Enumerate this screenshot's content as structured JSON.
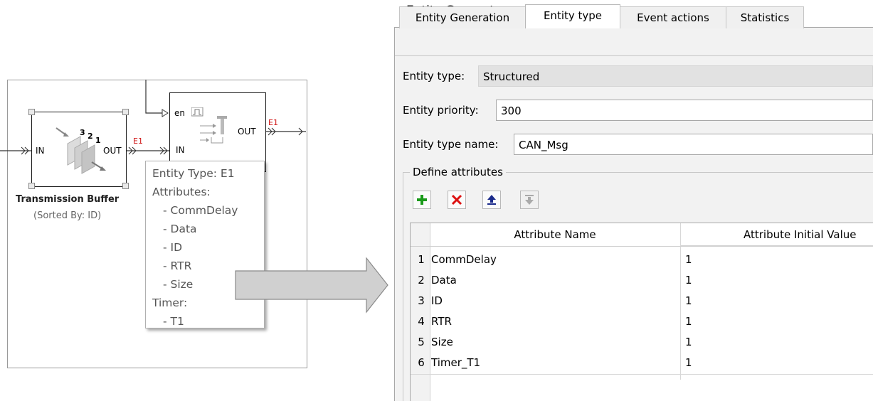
{
  "model": {
    "buffer_block": {
      "in_label": "IN",
      "out_label": "OUT",
      "digits": [
        "3",
        "2",
        "1"
      ],
      "title": "Transmission Buffer",
      "subtitle": "(Sorted By: ID)",
      "out_signal": "E1"
    },
    "gate_block": {
      "en_label": "en",
      "in_label": "IN",
      "out_label": "OUT",
      "out_signal": "E1"
    },
    "tooltip": {
      "lines": [
        "Entity Type: E1",
        "Attributes:",
        "- CommDelay",
        "- Data",
        "- ID",
        "- RTR",
        "- Size",
        "Timer:",
        "- T1"
      ]
    }
  },
  "dialog": {
    "title": "Entity Generator",
    "tabs": [
      {
        "label": "Entity Generation",
        "active": false
      },
      {
        "label": "Entity type",
        "active": true
      },
      {
        "label": "Event actions",
        "active": false
      },
      {
        "label": "Statistics",
        "active": false
      }
    ],
    "entity_type": {
      "label": "Entity type:",
      "value": "Structured"
    },
    "entity_priority": {
      "label": "Entity priority:",
      "value": "300"
    },
    "entity_type_name": {
      "label": "Entity type name:",
      "value": "CAN_Msg"
    },
    "attributes_group": {
      "label": "Define attributes",
      "toolbar": {
        "add": {
          "icon": "plus-icon",
          "color": "#1a9a1a"
        },
        "delete": {
          "icon": "x-icon",
          "color": "#dd1111"
        },
        "move_up": {
          "icon": "arrow-up-icon",
          "color": "#1a2a8a"
        },
        "move_down": {
          "icon": "arrow-down-icon",
          "color": "#aaaaaa",
          "disabled": true
        }
      },
      "columns": [
        "Attribute Name",
        "Attribute Initial Value"
      ],
      "rows": [
        {
          "index": "1",
          "name": "CommDelay",
          "value": "1"
        },
        {
          "index": "2",
          "name": "Data",
          "value": "1"
        },
        {
          "index": "3",
          "name": "ID",
          "value": "1"
        },
        {
          "index": "4",
          "name": "RTR",
          "value": "1"
        },
        {
          "index": "5",
          "name": "Size",
          "value": "1"
        },
        {
          "index": "6",
          "name": "Timer_T1",
          "value": "1"
        }
      ]
    }
  }
}
